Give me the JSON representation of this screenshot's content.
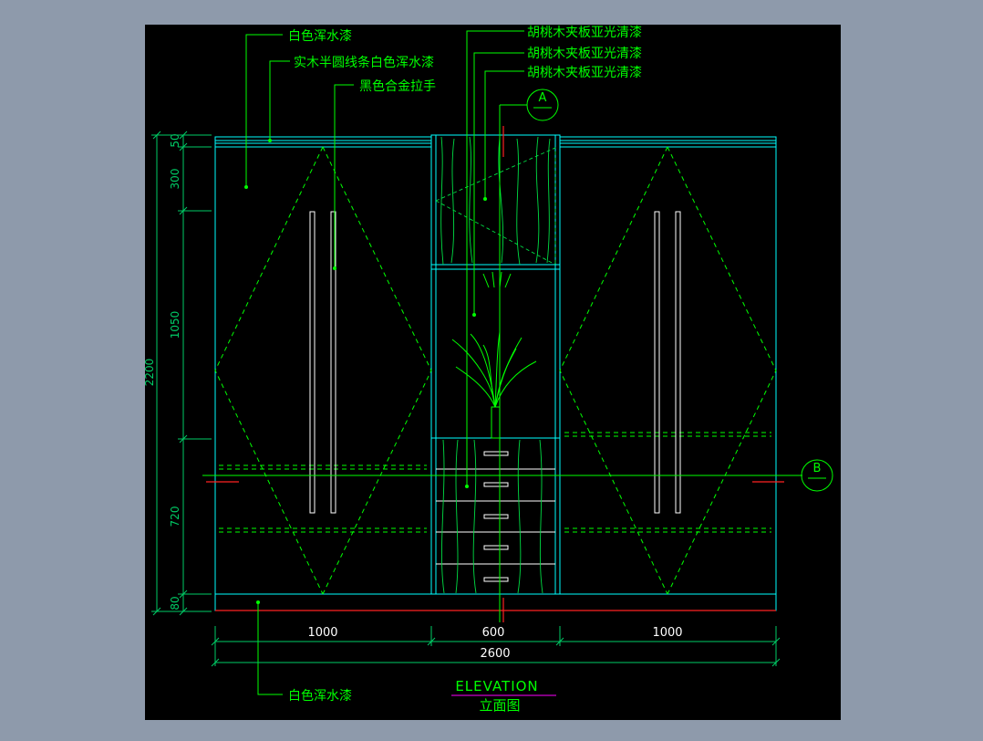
{
  "drawing": {
    "colors": {
      "app_background": "#8e9aab",
      "canvas_background": "#000000",
      "outline": "#00ffff",
      "leader": "#00ff00",
      "dimension": "#00cc66",
      "axis": "#00ff00",
      "wood_grain": "#00dd44",
      "cut_mark": "#ff0000",
      "title_underline": "#ff00ff",
      "handle": "#ffffff"
    },
    "callouts": {
      "top_left_1": "白色浑水漆",
      "top_left_2": "实木半圆线条白色浑水漆",
      "top_left_3": "黑色合金拉手",
      "top_right_1": "胡桃木夹板亚光清漆",
      "top_right_2": "胡桃木夹板亚光清漆",
      "top_right_3": "胡桃木夹板亚光清漆",
      "bottom": "白色浑水漆"
    },
    "section_markers": {
      "a": "A",
      "b": "B"
    },
    "dimensions": {
      "vertical": {
        "d50": "50",
        "d300": "300",
        "d1050": "1050",
        "d720": "720",
        "d80": "80",
        "total": "2200"
      },
      "horizontal": {
        "left": "1000",
        "middle": "600",
        "right": "1000",
        "total": "2600"
      }
    },
    "title": {
      "en": "ELEVATION",
      "cn": "立面图"
    }
  }
}
